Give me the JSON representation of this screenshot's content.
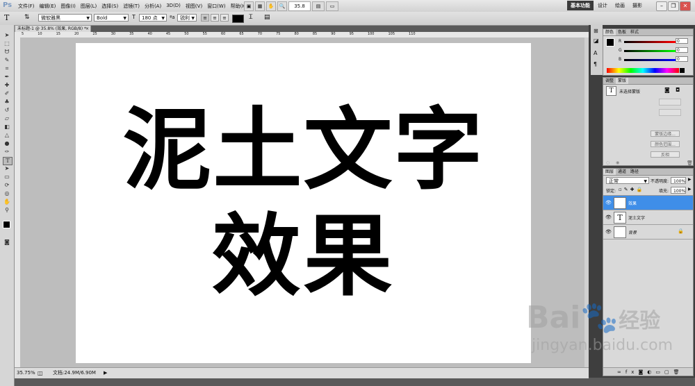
{
  "menubar": {
    "app_logo": "Ps",
    "menus": [
      "文件(F)",
      "编辑(E)",
      "图像(I)",
      "图层(L)",
      "选择(S)",
      "滤镜(T)",
      "分析(A)",
      "3D(D)",
      "视图(V)",
      "窗口(W)",
      "帮助(H)"
    ],
    "zoom_value": "35.8",
    "workspaces": [
      "基本功能",
      "设计",
      "绘画",
      "摄影"
    ],
    "window_controls": [
      "minimize-icon",
      "restore-icon",
      "close-icon"
    ]
  },
  "options": {
    "font_family": "微软雅黑",
    "font_style": "Bold",
    "font_size": "180 点",
    "antialias": "锐利"
  },
  "document": {
    "tab_title": "未标题-1 @ 35.8% (效果, RGB/8) *",
    "text_line1": "泥土文字",
    "text_line2": "效果",
    "ruler_top_ticks": [
      "5",
      "10",
      "15",
      "20",
      "25",
      "30",
      "35",
      "40",
      "45",
      "50",
      "55",
      "60",
      "65",
      "70",
      "75",
      "80",
      "85",
      "90",
      "95",
      "100",
      "105",
      "110"
    ],
    "status_zoom": "35.75%",
    "status_doc": "文档:24.9M/6.90M"
  },
  "color_panel": {
    "tabs": [
      "颜色",
      "色板",
      "样式"
    ],
    "channels": [
      {
        "label": "R",
        "value": "0"
      },
      {
        "label": "G",
        "value": "0"
      },
      {
        "label": "B",
        "value": "0"
      }
    ]
  },
  "adjust_panel": {
    "tabs": [
      "调整",
      "蒙版"
    ],
    "title": "未选择蒙版",
    "buttons": [
      "蒙版边缘...",
      "颜色范围...",
      "反相"
    ]
  },
  "layers_panel": {
    "tabs": [
      "图层",
      "通道",
      "路径"
    ],
    "blend_mode": "正常",
    "opacity_label": "不透明度:",
    "opacity_value": "100%",
    "lock_label": "锁定:",
    "fill_label": "填充:",
    "fill_value": "100%",
    "layers": [
      {
        "name": "效果",
        "thumb": "T",
        "selected": true
      },
      {
        "name": "泥土文字",
        "thumb": "T",
        "selected": false
      },
      {
        "name": "背景",
        "thumb": "",
        "selected": false
      }
    ]
  },
  "watermark": {
    "brand": "Bai",
    "brand2": "经验",
    "url": "jingyan.baidu.com"
  }
}
